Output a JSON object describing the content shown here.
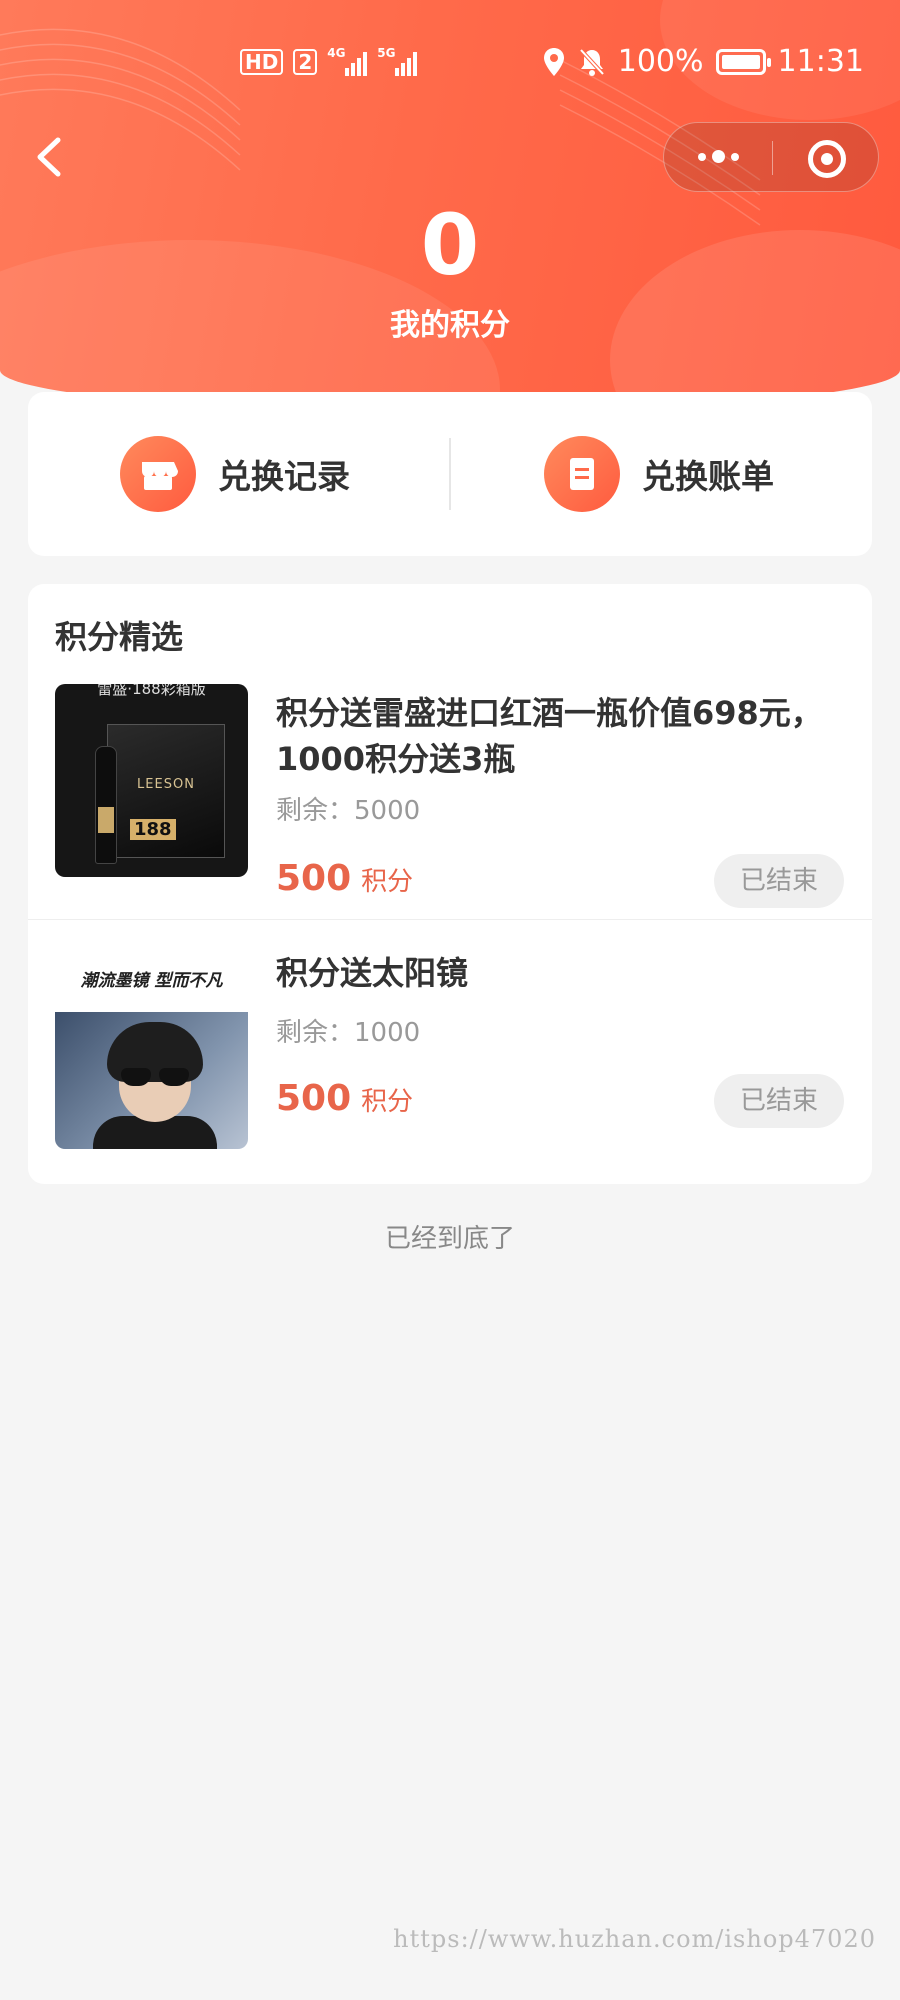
{
  "status_bar": {
    "hd_label": "HD",
    "sim_badge": "2",
    "signal1_label": "4G",
    "signal2_label": "5G",
    "battery": "100%",
    "time": "11:31"
  },
  "header": {
    "points_value": "0",
    "points_label": "我的积分"
  },
  "quick_links": [
    {
      "label": "兑换记录",
      "icon": "store-icon"
    },
    {
      "label": "兑换账单",
      "icon": "bill-icon"
    }
  ],
  "section": {
    "title": "积分精选"
  },
  "goods": [
    {
      "title": "积分送雷盛进口红酒一瓶价值698元，1000积分送3瓶",
      "stock": "剩余：5000",
      "price": "500",
      "unit": "积分",
      "button": "已结束",
      "image_top_text": "雷盛·188彩箱版",
      "image_brand": "LEESON",
      "image_number": "188"
    },
    {
      "title": "积分送太阳镜",
      "stock": "剩余：1000",
      "price": "500",
      "unit": "积分",
      "button": "已结束",
      "image_caption": "潮流墨镜 型而不凡"
    }
  ],
  "footer": {
    "end_text": "已经到底了",
    "watermark": "https://www.huzhan.com/ishop47020"
  },
  "colors": {
    "header_start": "#ff7a5a",
    "header_end": "#ff5a3e",
    "price": "#e8654a",
    "ended_button_bg": "#efefef"
  }
}
